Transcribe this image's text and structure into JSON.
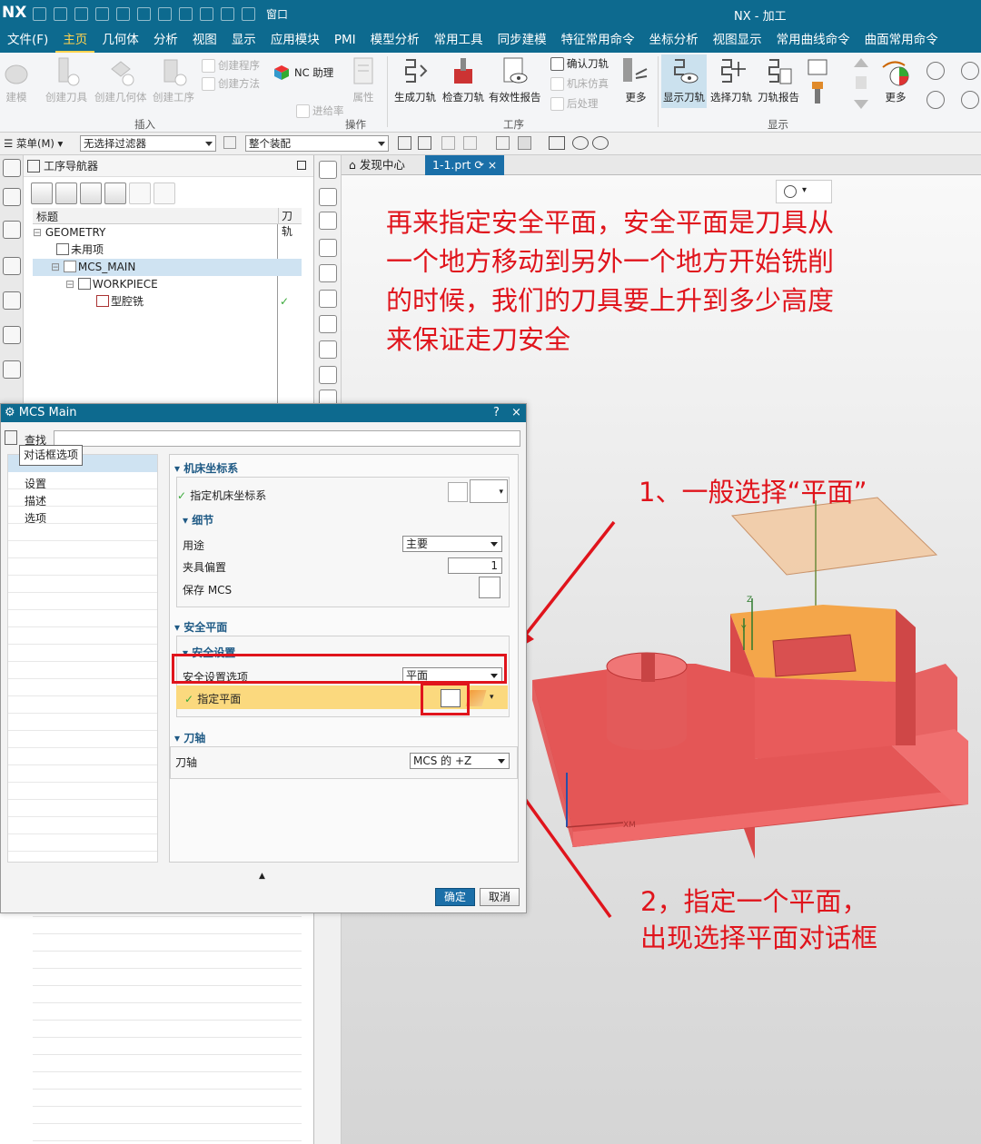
{
  "app": {
    "logo": "NX",
    "window_title": "NX - 加工",
    "window_menu": "窗口"
  },
  "menubar": [
    "文件(F)",
    "主页",
    "几何体",
    "分析",
    "视图",
    "显示",
    "应用模块",
    "PMI",
    "模型分析",
    "常用工具",
    "同步建模",
    "特征常用命令",
    "坐标分析",
    "视图显示",
    "常用曲线命令",
    "曲面常用命令"
  ],
  "active_menu": "主页",
  "ribbon": {
    "buttons": [
      "建模",
      "创建刀具",
      "创建几何体",
      "创建工序",
      "NC 助理",
      "属性",
      "生成刀轨",
      "检查刀轨",
      "有效性报告",
      "更多",
      "显示刀轨",
      "选择刀轨",
      "刀轨报告",
      "更多"
    ],
    "small": [
      "创建程序",
      "创建方法",
      "进给率",
      "确认刀轨",
      "机床仿真",
      "后处理"
    ],
    "groups": [
      "插入",
      "操作",
      "工序",
      "显示"
    ]
  },
  "filterbar": {
    "menu": "菜单(M)",
    "filter": "无选择过滤器",
    "assembly": "整个装配"
  },
  "navigator": {
    "title": "工序导航器",
    "col_title": "标题",
    "col_path": "刀轨",
    "rows": [
      "GEOMETRY",
      "未用项",
      "MCS_MAIN",
      "WORKPIECE",
      "型腔铣"
    ]
  },
  "graphics_tabs": {
    "discover": "发现中心",
    "part": "1-1.prt"
  },
  "annotations": {
    "top": "再来指定安全平面，安全平面是刀具从\n一个地方移动到另外一个地方开始铣削\n的时候，我们的刀具要上升到多少高度\n来保证走刀安全",
    "step1": "1、一般选择“平面”",
    "step2": "2，指定一个平面，\n出现选择平面对话框"
  },
  "dialog": {
    "title": "MCS Main",
    "help": "?",
    "close": "×",
    "search": "查找",
    "tooltip": "对话框选项",
    "nav": [
      "设置",
      "描述",
      "选项"
    ],
    "sec_machine": "机床坐标系",
    "specify_mcs": "指定机床坐标系",
    "sec_detail": "细节",
    "purpose_label": "用途",
    "purpose_value": "主要",
    "fixture_label": "夹具偏置",
    "fixture_value": "1",
    "save_mcs": "保存 MCS",
    "sec_safe": "安全平面",
    "sec_safe_set": "安全设置",
    "safe_option_label": "安全设置选项",
    "safe_option_value": "平面",
    "specify_plane": "指定平面",
    "sec_axis": "刀轴",
    "axis_label": "刀轴",
    "axis_value": "MCS 的 +Z",
    "ok": "确定",
    "cancel": "取消"
  },
  "model_labels": {
    "z": "Z",
    "y": "Y",
    "xm": "XM"
  },
  "colors": {
    "title_bar": "#0d6a8f",
    "accent_red": "#e0141c",
    "part": "#ef6060",
    "part_top": "#f4a64a",
    "highlight": "#fbd97e"
  }
}
